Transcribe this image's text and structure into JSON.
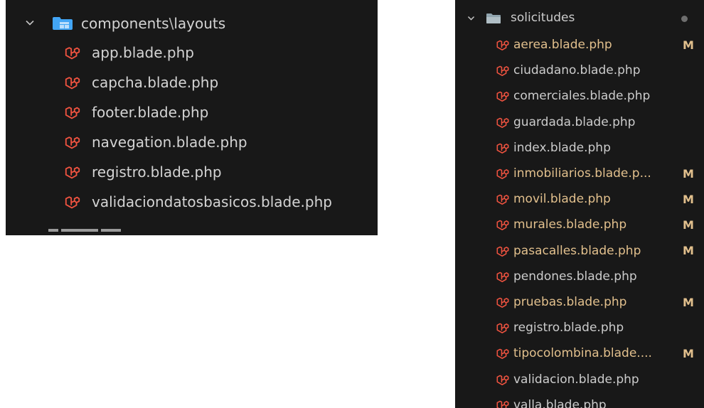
{
  "left_panel": {
    "folder": {
      "parts": [
        "components",
        "layouts"
      ],
      "separator": "\\"
    },
    "files": [
      "app.blade.php",
      "capcha.blade.php",
      "footer.blade.php",
      "navegation.blade.php",
      "registro.blade.php",
      "validaciondatosbasicos.blade.php"
    ]
  },
  "right_panel": {
    "folder": {
      "name": "solicitudes"
    },
    "files": [
      {
        "name": "aerea.blade.php",
        "status": "M"
      },
      {
        "name": "ciudadano.blade.php",
        "status": ""
      },
      {
        "name": "comerciales.blade.php",
        "status": ""
      },
      {
        "name": "guardada.blade.php",
        "status": ""
      },
      {
        "name": "index.blade.php",
        "status": ""
      },
      {
        "name": "inmobiliarios.blade.p...",
        "status": "M"
      },
      {
        "name": "movil.blade.php",
        "status": "M"
      },
      {
        "name": "murales.blade.php",
        "status": "M"
      },
      {
        "name": "pasacalles.blade.php",
        "status": "M"
      },
      {
        "name": "pendones.blade.php",
        "status": ""
      },
      {
        "name": "pruebas.blade.php",
        "status": "M"
      },
      {
        "name": "registro.blade.php",
        "status": ""
      },
      {
        "name": "tipocolombina.blade....",
        "status": "M"
      },
      {
        "name": "validacion.blade.php",
        "status": ""
      },
      {
        "name": "valla.blade.php",
        "status": ""
      }
    ]
  },
  "icons": {
    "chevron": "chevron-down-icon",
    "folder_left": "folder-layouts-icon",
    "folder_right": "folder-icon",
    "file": "laravel-icon"
  },
  "colors": {
    "panel_bg": "#181818",
    "text": "#cccccc",
    "modified": "#e2c08d",
    "laravel": "#f05340",
    "folder_blue": "#42a5f5"
  }
}
